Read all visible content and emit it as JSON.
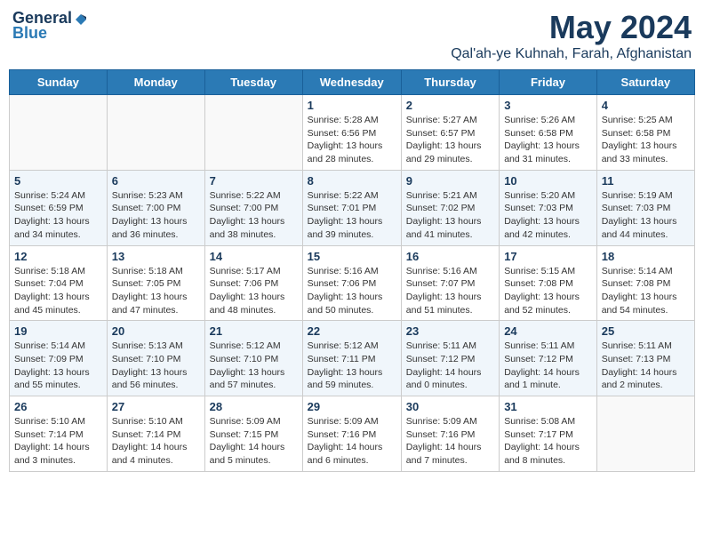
{
  "header": {
    "logo_general": "General",
    "logo_blue": "Blue",
    "month": "May 2024",
    "location": "Qal'ah-ye Kuhnah, Farah, Afghanistan"
  },
  "weekdays": [
    "Sunday",
    "Monday",
    "Tuesday",
    "Wednesday",
    "Thursday",
    "Friday",
    "Saturday"
  ],
  "weeks": [
    [
      {
        "day": "",
        "info": ""
      },
      {
        "day": "",
        "info": ""
      },
      {
        "day": "",
        "info": ""
      },
      {
        "day": "1",
        "info": "Sunrise: 5:28 AM\nSunset: 6:56 PM\nDaylight: 13 hours\nand 28 minutes."
      },
      {
        "day": "2",
        "info": "Sunrise: 5:27 AM\nSunset: 6:57 PM\nDaylight: 13 hours\nand 29 minutes."
      },
      {
        "day": "3",
        "info": "Sunrise: 5:26 AM\nSunset: 6:58 PM\nDaylight: 13 hours\nand 31 minutes."
      },
      {
        "day": "4",
        "info": "Sunrise: 5:25 AM\nSunset: 6:58 PM\nDaylight: 13 hours\nand 33 minutes."
      }
    ],
    [
      {
        "day": "5",
        "info": "Sunrise: 5:24 AM\nSunset: 6:59 PM\nDaylight: 13 hours\nand 34 minutes."
      },
      {
        "day": "6",
        "info": "Sunrise: 5:23 AM\nSunset: 7:00 PM\nDaylight: 13 hours\nand 36 minutes."
      },
      {
        "day": "7",
        "info": "Sunrise: 5:22 AM\nSunset: 7:00 PM\nDaylight: 13 hours\nand 38 minutes."
      },
      {
        "day": "8",
        "info": "Sunrise: 5:22 AM\nSunset: 7:01 PM\nDaylight: 13 hours\nand 39 minutes."
      },
      {
        "day": "9",
        "info": "Sunrise: 5:21 AM\nSunset: 7:02 PM\nDaylight: 13 hours\nand 41 minutes."
      },
      {
        "day": "10",
        "info": "Sunrise: 5:20 AM\nSunset: 7:03 PM\nDaylight: 13 hours\nand 42 minutes."
      },
      {
        "day": "11",
        "info": "Sunrise: 5:19 AM\nSunset: 7:03 PM\nDaylight: 13 hours\nand 44 minutes."
      }
    ],
    [
      {
        "day": "12",
        "info": "Sunrise: 5:18 AM\nSunset: 7:04 PM\nDaylight: 13 hours\nand 45 minutes."
      },
      {
        "day": "13",
        "info": "Sunrise: 5:18 AM\nSunset: 7:05 PM\nDaylight: 13 hours\nand 47 minutes."
      },
      {
        "day": "14",
        "info": "Sunrise: 5:17 AM\nSunset: 7:06 PM\nDaylight: 13 hours\nand 48 minutes."
      },
      {
        "day": "15",
        "info": "Sunrise: 5:16 AM\nSunset: 7:06 PM\nDaylight: 13 hours\nand 50 minutes."
      },
      {
        "day": "16",
        "info": "Sunrise: 5:16 AM\nSunset: 7:07 PM\nDaylight: 13 hours\nand 51 minutes."
      },
      {
        "day": "17",
        "info": "Sunrise: 5:15 AM\nSunset: 7:08 PM\nDaylight: 13 hours\nand 52 minutes."
      },
      {
        "day": "18",
        "info": "Sunrise: 5:14 AM\nSunset: 7:08 PM\nDaylight: 13 hours\nand 54 minutes."
      }
    ],
    [
      {
        "day": "19",
        "info": "Sunrise: 5:14 AM\nSunset: 7:09 PM\nDaylight: 13 hours\nand 55 minutes."
      },
      {
        "day": "20",
        "info": "Sunrise: 5:13 AM\nSunset: 7:10 PM\nDaylight: 13 hours\nand 56 minutes."
      },
      {
        "day": "21",
        "info": "Sunrise: 5:12 AM\nSunset: 7:10 PM\nDaylight: 13 hours\nand 57 minutes."
      },
      {
        "day": "22",
        "info": "Sunrise: 5:12 AM\nSunset: 7:11 PM\nDaylight: 13 hours\nand 59 minutes."
      },
      {
        "day": "23",
        "info": "Sunrise: 5:11 AM\nSunset: 7:12 PM\nDaylight: 14 hours\nand 0 minutes."
      },
      {
        "day": "24",
        "info": "Sunrise: 5:11 AM\nSunset: 7:12 PM\nDaylight: 14 hours\nand 1 minute."
      },
      {
        "day": "25",
        "info": "Sunrise: 5:11 AM\nSunset: 7:13 PM\nDaylight: 14 hours\nand 2 minutes."
      }
    ],
    [
      {
        "day": "26",
        "info": "Sunrise: 5:10 AM\nSunset: 7:14 PM\nDaylight: 14 hours\nand 3 minutes."
      },
      {
        "day": "27",
        "info": "Sunrise: 5:10 AM\nSunset: 7:14 PM\nDaylight: 14 hours\nand 4 minutes."
      },
      {
        "day": "28",
        "info": "Sunrise: 5:09 AM\nSunset: 7:15 PM\nDaylight: 14 hours\nand 5 minutes."
      },
      {
        "day": "29",
        "info": "Sunrise: 5:09 AM\nSunset: 7:16 PM\nDaylight: 14 hours\nand 6 minutes."
      },
      {
        "day": "30",
        "info": "Sunrise: 5:09 AM\nSunset: 7:16 PM\nDaylight: 14 hours\nand 7 minutes."
      },
      {
        "day": "31",
        "info": "Sunrise: 5:08 AM\nSunset: 7:17 PM\nDaylight: 14 hours\nand 8 minutes."
      },
      {
        "day": "",
        "info": ""
      }
    ]
  ]
}
